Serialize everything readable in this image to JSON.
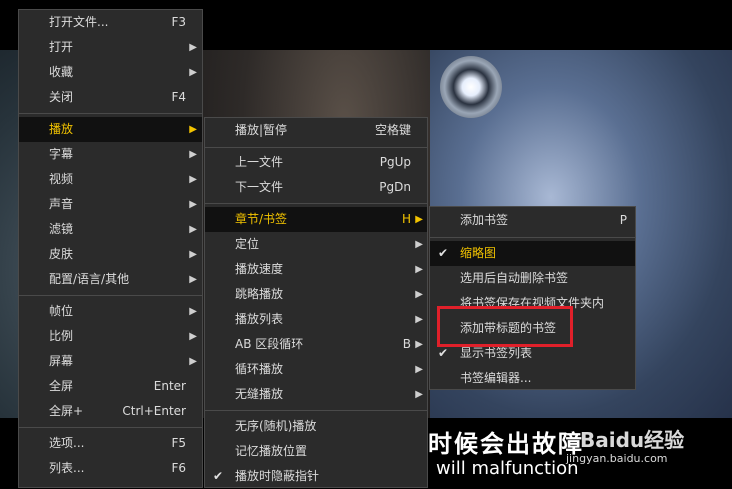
{
  "video": {
    "subtitle_cn": "时候会出故障",
    "subtitle_en": "will malfunction",
    "watermark": "Baidu经验",
    "watermark_url": "jingyan.baidu.com"
  },
  "main_menu": {
    "items": [
      {
        "label": "打开文件...",
        "shortcut": "F3"
      },
      {
        "label": "打开",
        "arrow": "▶"
      },
      {
        "label": "收藏",
        "arrow": "▶"
      },
      {
        "label": "关闭",
        "shortcut": "F4"
      },
      {
        "label": "播放",
        "arrow": "▶"
      },
      {
        "label": "字幕",
        "arrow": "▶"
      },
      {
        "label": "视频",
        "arrow": "▶"
      },
      {
        "label": "声音",
        "arrow": "▶"
      },
      {
        "label": "滤镜",
        "arrow": "▶"
      },
      {
        "label": "皮肤",
        "arrow": "▶"
      },
      {
        "label": "配置/语言/其他",
        "arrow": "▶"
      },
      {
        "label": "帧位",
        "arrow": "▶"
      },
      {
        "label": "比例",
        "arrow": "▶"
      },
      {
        "label": "屏幕",
        "arrow": "▶"
      },
      {
        "label": "全屏",
        "shortcut": "Enter"
      },
      {
        "label": "全屏+",
        "shortcut": "Ctrl+Enter"
      },
      {
        "label": "选项...",
        "shortcut": "F5"
      },
      {
        "label": "列表...",
        "shortcut": "F6"
      }
    ]
  },
  "play_menu": {
    "items": [
      {
        "label": "播放|暂停",
        "shortcut": "空格键"
      },
      {
        "label": "上一文件",
        "shortcut": "PgUp"
      },
      {
        "label": "下一文件",
        "shortcut": "PgDn"
      },
      {
        "label": "章节/书签",
        "shortcut": "H",
        "arrow": "▶"
      },
      {
        "label": "定位",
        "arrow": "▶"
      },
      {
        "label": "播放速度",
        "arrow": "▶"
      },
      {
        "label": "跳略播放",
        "arrow": "▶"
      },
      {
        "label": "播放列表",
        "arrow": "▶"
      },
      {
        "label": "AB 区段循环",
        "shortcut": "B",
        "arrow": "▶"
      },
      {
        "label": "循环播放",
        "arrow": "▶"
      },
      {
        "label": "无缝播放",
        "arrow": "▶"
      },
      {
        "label": "无序(随机)播放"
      },
      {
        "label": "记忆播放位置"
      },
      {
        "label": "播放时隐蔽指针",
        "check": "✔"
      }
    ]
  },
  "bookmark_menu": {
    "items": [
      {
        "label": "添加书签",
        "shortcut": "P"
      },
      {
        "label": "缩略图",
        "check": "✔"
      },
      {
        "label": "选用后自动删除书签"
      },
      {
        "label": "将书签保存在视频文件夹内"
      },
      {
        "label": "添加带标题的书签"
      },
      {
        "label": "显示书签列表",
        "check": "✔"
      },
      {
        "label": "书签编辑器..."
      }
    ]
  },
  "colors": {
    "menu_bg": "#2b2b2b",
    "active_text": "#f2c300",
    "highlight_box": "#e0202a"
  }
}
